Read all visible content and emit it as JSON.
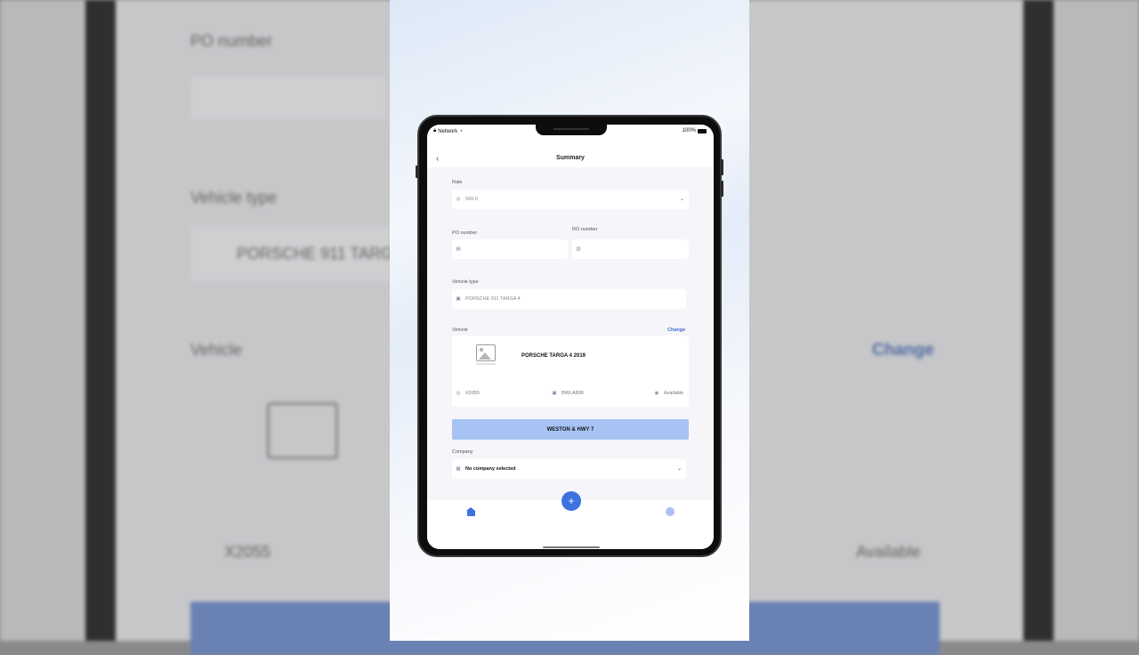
{
  "background": {
    "po_label": "PO number",
    "vehicle_type_label": "Vehicle type",
    "vehicle_type_value": "PORSCHE 911 TARG",
    "vehicle_label": "Vehicle",
    "change_label": "Change",
    "plate": "X2055",
    "availability": "Available"
  },
  "status_bar": {
    "carrier": "Network",
    "battery": "100%"
  },
  "nav": {
    "back_icon": "chevron-left-icon",
    "back_glyph": "‹",
    "title": "Summary"
  },
  "form": {
    "rate_label": "Rate",
    "rate_value": "500.0",
    "po_label": "PO number",
    "po_value": "",
    "ro_label": "RO number",
    "ro_value": "",
    "vehicle_type_label": "Vehicle type",
    "vehicle_type_value": "PORSCHE 911 TARGA 4",
    "vehicle_label": "Vehicle",
    "change_label": "Change",
    "company_label": "Company",
    "company_value": "No company selected"
  },
  "vehicle": {
    "name": "PORSCHE TARGA 4 2019",
    "plate": "X2055",
    "code": "BWLA808",
    "status": "Available"
  },
  "location_button": {
    "label": "WESTON & HWY 7"
  },
  "tabbar": {
    "fab_glyph": "+",
    "home_icon": "home-icon",
    "profile_icon": "profile-icon"
  },
  "colors": {
    "accent": "#3d71de",
    "location_button": "#a7c3f4",
    "link": "#3b6fd4"
  }
}
